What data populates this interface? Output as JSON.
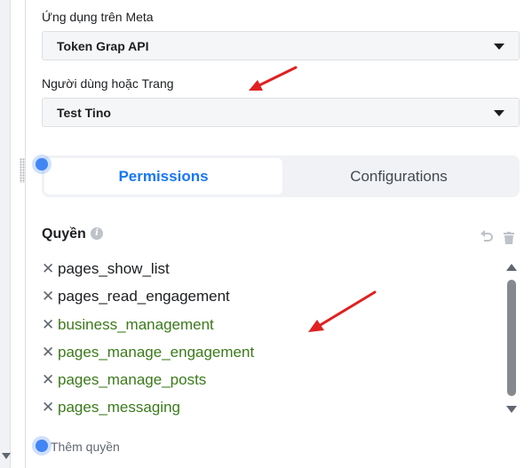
{
  "app_field": {
    "label": "Ứng dụng trên Meta",
    "value": "Token Grap API"
  },
  "user_field": {
    "label": "Người dùng hoặc Trang",
    "value": "Test Tino"
  },
  "tabs": [
    {
      "label": "Permissions",
      "active": true
    },
    {
      "label": "Configurations",
      "active": false
    }
  ],
  "permissions_section": {
    "title": "Quyền",
    "info_icon": "i",
    "items": [
      {
        "name": "pages_show_list",
        "color": "#1c1e21"
      },
      {
        "name": "pages_read_engagement",
        "color": "#1c1e21"
      },
      {
        "name": "business_management",
        "color": "#3b7a1a"
      },
      {
        "name": "pages_manage_engagement",
        "color": "#3b7a1a"
      },
      {
        "name": "pages_manage_posts",
        "color": "#3b7a1a"
      },
      {
        "name": "pages_messaging",
        "color": "#3b7a1a"
      }
    ],
    "remove_glyph": "✕",
    "add_placeholder": "Thêm quyền"
  },
  "colors": {
    "accent": "#1877f2",
    "granted": "#3b7a1a",
    "arrow": "#e02020"
  }
}
